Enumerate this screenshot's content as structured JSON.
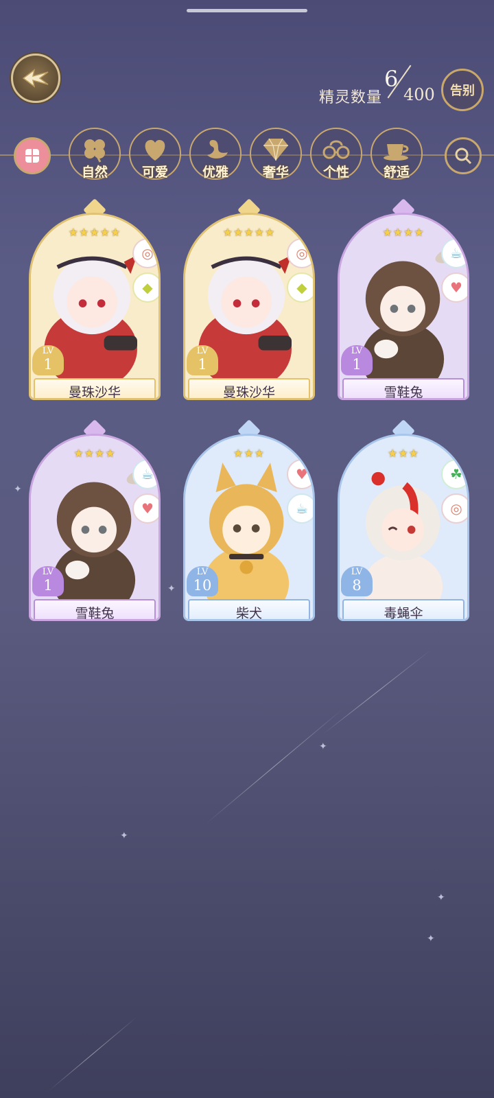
{
  "header": {
    "count_label": "精灵数量",
    "count_current": "6",
    "count_max": "400",
    "farewell_label": "告别"
  },
  "filters": [
    {
      "label": "自然",
      "icon": "clover-icon"
    },
    {
      "label": "可爱",
      "icon": "heart-icon"
    },
    {
      "label": "优雅",
      "icon": "swan-icon"
    },
    {
      "label": "奢华",
      "icon": "diamond-icon"
    },
    {
      "label": "个性",
      "icon": "glasses-icon"
    },
    {
      "label": "舒适",
      "icon": "teacup-icon"
    }
  ],
  "spirits": [
    {
      "name": "曼珠沙华",
      "level": "1",
      "lv_label": "LV",
      "stars": "★★★★★",
      "rarity": "gold",
      "tags": [
        "glasses-icon",
        "diamond-icon"
      ]
    },
    {
      "name": "曼珠沙华",
      "level": "1",
      "lv_label": "LV",
      "stars": "★★★★★",
      "rarity": "gold",
      "tags": [
        "glasses-icon",
        "diamond-icon"
      ]
    },
    {
      "name": "雪鞋兔",
      "level": "1",
      "lv_label": "LV",
      "stars": "★★★★",
      "rarity": "purple",
      "tags": [
        "teacup-icon",
        "heart-icon"
      ]
    },
    {
      "name": "雪鞋兔",
      "level": "1",
      "lv_label": "LV",
      "stars": "★★★★",
      "rarity": "purple",
      "tags": [
        "teacup-icon",
        "heart-icon"
      ]
    },
    {
      "name": "柴犬",
      "level": "10",
      "lv_label": "LV",
      "stars": "★★★",
      "rarity": "blue",
      "tags": [
        "heart-icon",
        "teacup-icon"
      ]
    },
    {
      "name": "毒蝇伞",
      "level": "8",
      "lv_label": "LV",
      "stars": "★★★",
      "rarity": "blue",
      "tags": [
        "clover-icon",
        "glasses-icon"
      ]
    }
  ],
  "colors": {
    "gold": "#e0c274",
    "purple": "#c9a6e0",
    "blue": "#a9c5ea",
    "accent": "#c9a86f"
  }
}
